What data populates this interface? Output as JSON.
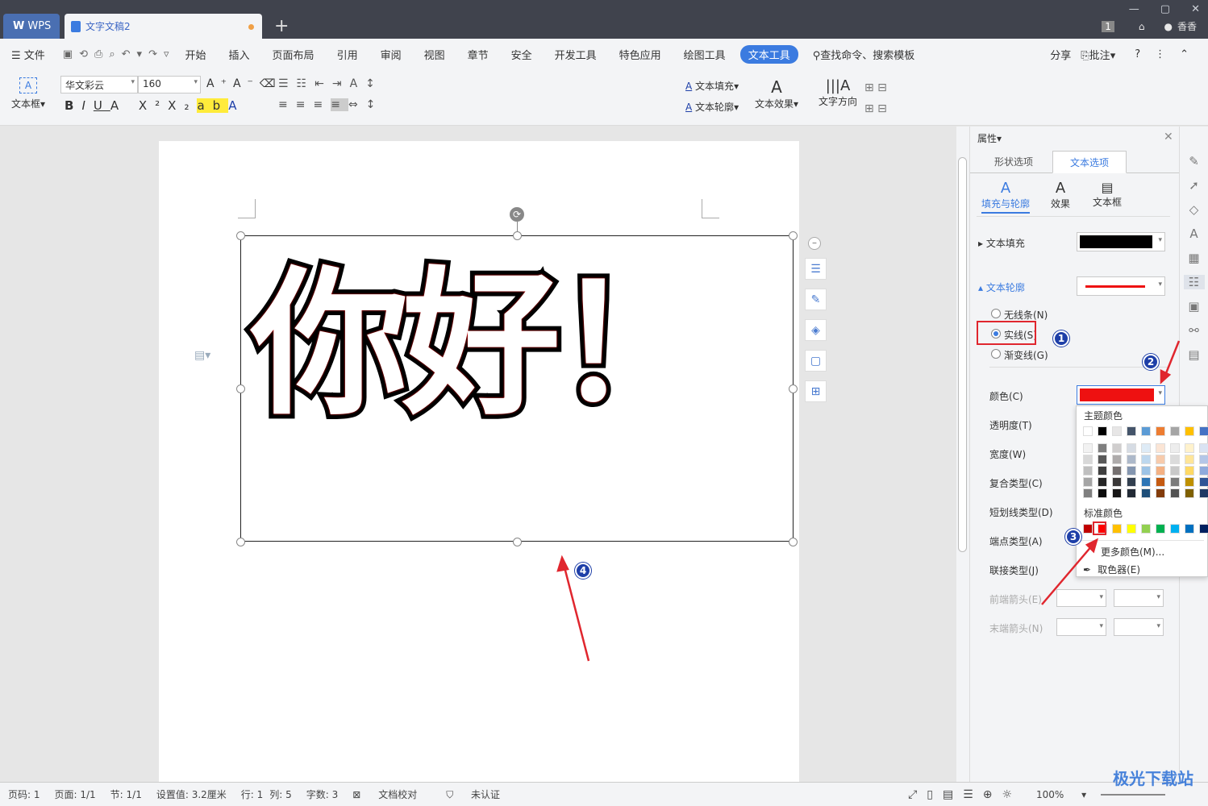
{
  "titlebar": {
    "app_tab": "WPS",
    "doc_tab": "文字文稿2",
    "new_tab": "+",
    "user": "香香",
    "window_count": "1"
  },
  "menu": {
    "file": "文件",
    "items": [
      "开始",
      "插入",
      "页面布局",
      "引用",
      "审阅",
      "视图",
      "章节",
      "安全",
      "开发工具",
      "特色应用",
      "绘图工具",
      "文本工具"
    ],
    "active": "文本工具",
    "search": "查找命令、搜索模板",
    "share": "分享",
    "comment": "批注"
  },
  "ribbon": {
    "textbox": "文本框",
    "font": "华文彩云",
    "size": "160",
    "text_fill": "文本填充",
    "text_outline": "文本轮廓",
    "text_effect": "文本效果",
    "text_direction": "文字方向",
    "gallery_letter": "A"
  },
  "document": {
    "text": "你好！"
  },
  "panel": {
    "title": "属性",
    "tabs": [
      "形状选项",
      "文本选项"
    ],
    "subtabs": [
      "填充与轮廓",
      "效果",
      "文本框"
    ],
    "fill_label": "文本填充",
    "outline_label": "文本轮廓",
    "radios": [
      "无线条(N)",
      "实线(S)",
      "渐变线(G)"
    ],
    "fields": [
      "颜色(C)",
      "透明度(T)",
      "宽度(W)",
      "复合类型(C)",
      "短划线类型(D)",
      "端点类型(A)",
      "联接类型(J)",
      "前端箭头(E)",
      "末端箭头(N)"
    ]
  },
  "colors": {
    "fill": "#000000",
    "outline": "#ee1111",
    "accent": "#3b7be0",
    "theme_top": [
      "#ffffff",
      "#000000",
      "#e7e6e6",
      "#44546a",
      "#5b9bd5",
      "#ed7d31",
      "#a5a5a5",
      "#ffc000",
      "#4472c4"
    ],
    "theme_rows": [
      [
        "#f2f2f2",
        "#7f7f7f",
        "#d0cece",
        "#d6dce4",
        "#deebf6",
        "#fbe5d5",
        "#ededed",
        "#fff2cc",
        "#dae3f3"
      ],
      [
        "#d8d8d8",
        "#595959",
        "#aeabab",
        "#adb9ca",
        "#bdd7ee",
        "#f7cbac",
        "#dbdbdb",
        "#fee599",
        "#b4c6e7"
      ],
      [
        "#bfbfbf",
        "#3f3f3f",
        "#757070",
        "#8496b0",
        "#9dc3e6",
        "#f4b183",
        "#c9c9c9",
        "#ffd965",
        "#8faadc"
      ],
      [
        "#a5a5a5",
        "#262626",
        "#3a3838",
        "#323f4f",
        "#2e75b5",
        "#c55a11",
        "#7b7b7b",
        "#bf9000",
        "#2f5496"
      ],
      [
        "#7f7f7f",
        "#0c0c0c",
        "#171616",
        "#222a35",
        "#1e4e79",
        "#833c0b",
        "#525252",
        "#7f6000",
        "#1f3864"
      ]
    ],
    "standard": [
      "#c00000",
      "#ff0000",
      "#ffc000",
      "#ffff00",
      "#92d050",
      "#00b050",
      "#00b0f0",
      "#0070c0",
      "#002060"
    ]
  },
  "color_dropdown": {
    "theme_title": "主题颜色",
    "standard_title": "标准颜色",
    "more": "更多颜色(M)...",
    "picker": "取色器(E)"
  },
  "status": {
    "page": "页码: 1",
    "pages": "页面: 1/1",
    "section": "节: 1/1",
    "setting": "设置值: 3.2厘米",
    "row": "行: 1",
    "col": "列: 5",
    "words": "字数: 3",
    "proof": "文档校对",
    "cert": "未认证",
    "zoom": "100%"
  },
  "badges": [
    "1",
    "2",
    "3",
    "4"
  ],
  "watermark": "极光下载站"
}
